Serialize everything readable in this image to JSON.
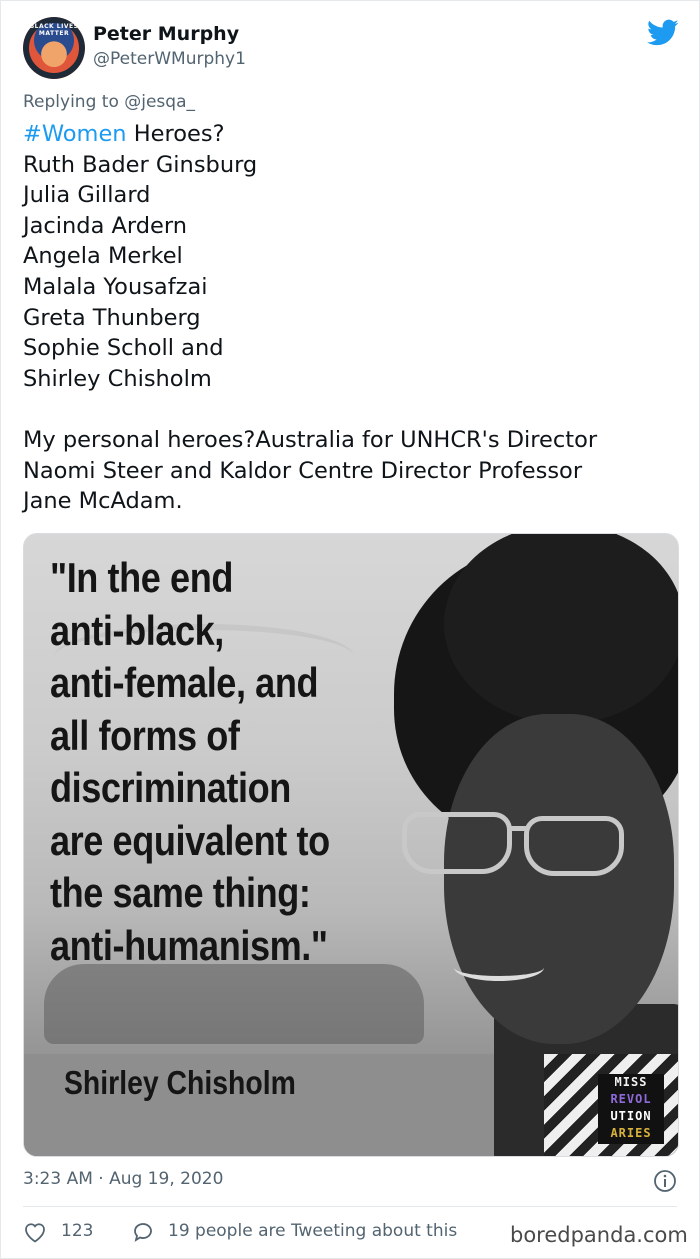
{
  "tweet": {
    "author_name": "Peter Murphy",
    "author_handle": "@PeterWMurphy1",
    "avatar_text": "BLACK LIVES MATTER",
    "replying_label": "Replying to",
    "replying_to": "@jesqa_",
    "hashtag": "#Women",
    "heading_rest": " Heroes?",
    "heroes": [
      "Ruth Bader Ginsburg",
      "Julia Gillard",
      "Jacinda Ardern",
      "Angela Merkel",
      "Malala Yousafzai",
      "Greta Thunberg",
      "Sophie Scholl and",
      "Shirley Chisholm"
    ],
    "personal_heroes": [
      "My personal heroes?Australia for UNHCR's Director",
      "Naomi Steer and Kaldor Centre Director Professor",
      "Jane McAdam."
    ],
    "timestamp": "3:23 AM · Aug 19, 2020",
    "like_count": "123",
    "tweeting_text": "19 people are Tweeting about this"
  },
  "media": {
    "quote_lines": [
      "\"In the end",
      "anti-black,",
      "anti-female, and",
      "all forms of",
      "discrimination",
      "are equivalent to",
      "the same thing:",
      "anti-humanism.\""
    ],
    "quote_author": "Shirley Chisholm",
    "logo_lines": [
      "MISS",
      "REVOL",
      "UTION",
      "ARIES"
    ]
  },
  "watermark": "boredpanda.com",
  "colors": {
    "link": "#1d9bf0",
    "muted": "#536471",
    "text": "#0f1419",
    "twitter_blue": "#1d9bf0"
  },
  "icons": [
    "twitter-bird-icon",
    "info-icon",
    "heart-icon",
    "reply-bubble-icon"
  ]
}
